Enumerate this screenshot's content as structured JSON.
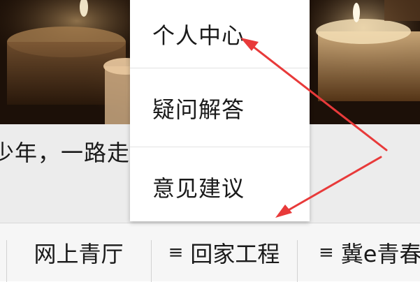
{
  "banner": {
    "description_icon": "candles-photo"
  },
  "caption": {
    "text": "少年，一路走好"
  },
  "popup_menu": {
    "items": [
      {
        "label": "个人中心"
      },
      {
        "label": "疑问解答"
      },
      {
        "label": "意见建议"
      }
    ]
  },
  "tabbar": {
    "tabs": [
      {
        "label": "网上青厅",
        "icon": ""
      },
      {
        "label": "回家工程",
        "icon": "menu-icon"
      },
      {
        "label": "冀e青春",
        "icon": "menu-icon"
      }
    ],
    "menu_glyph": "≡"
  },
  "colors": {
    "annotation_red": "#e83a3a",
    "banner_dark": "#1a0e05",
    "caption_bg": "#ececec",
    "tabbar_bg": "#f6f6f6"
  }
}
